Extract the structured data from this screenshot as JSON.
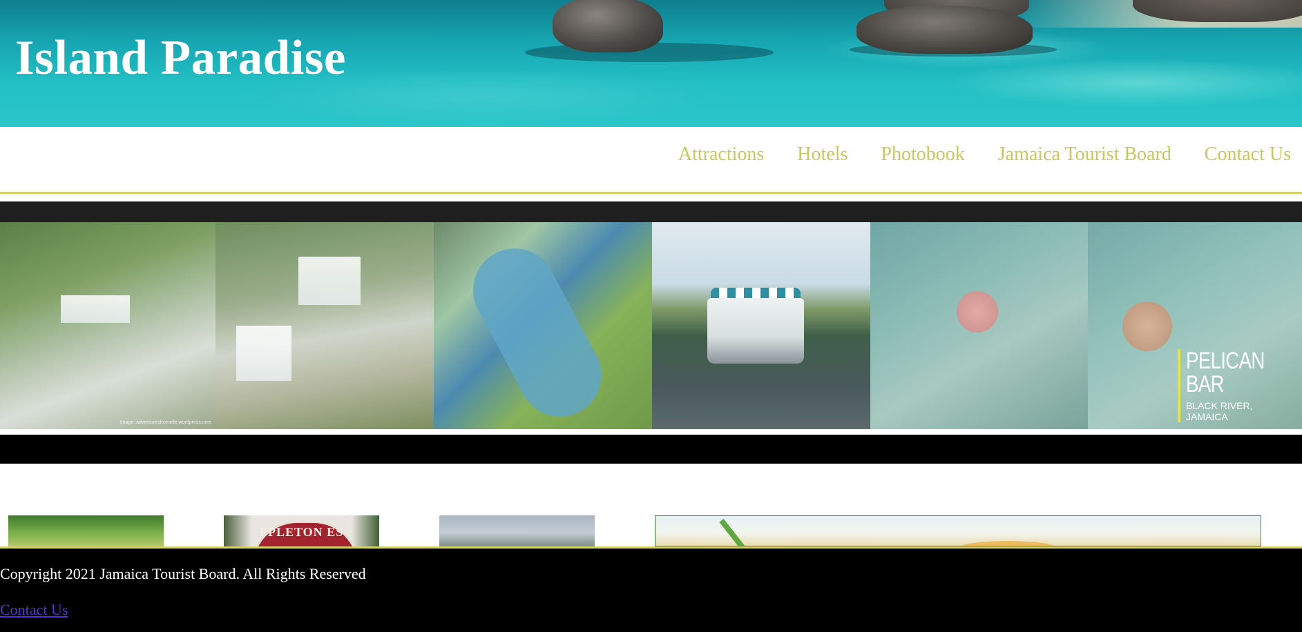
{
  "header": {
    "site_title": "Island Paradise"
  },
  "nav": {
    "items": [
      {
        "label": "Attractions"
      },
      {
        "label": "Hotels"
      },
      {
        "label": "Photobook"
      },
      {
        "label": "Jamaica Tourist Board"
      },
      {
        "label": "Contact Us"
      }
    ]
  },
  "gallery": {
    "tile1_credit": "Image: adventuresfromelle.wordpress.com",
    "pelican_title": "PELICAN BAR",
    "pelican_subtitle": "BLACK RIVER, JAMAICA"
  },
  "thumbnails": {
    "sign_text": "PPLETON ES"
  },
  "footer": {
    "copyright": "Copyright 2021 Jamaica Tourist Board. All Rights Reserved",
    "contact_link": "Contact Us"
  },
  "colors": {
    "nav_link": "#c9c85a",
    "accent_border": "#d4d46a",
    "footer_bg": "#000000",
    "footer_link": "#5b2fd6"
  }
}
